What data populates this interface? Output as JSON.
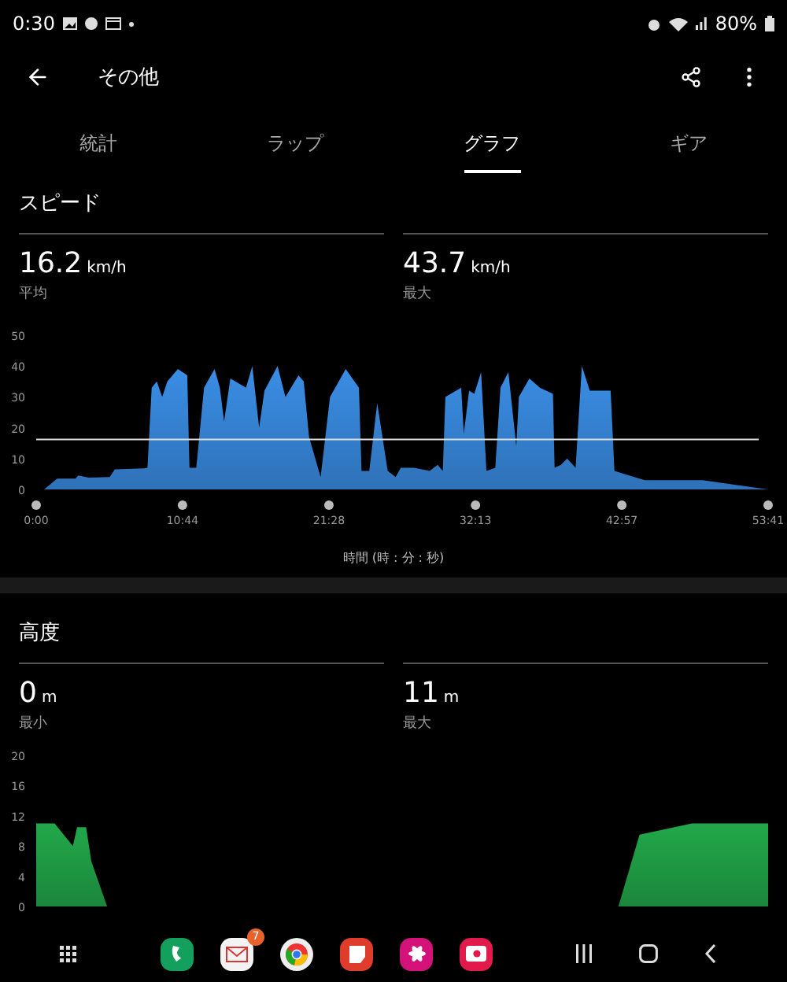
{
  "status_bar": {
    "time": "0:30",
    "battery": "80%"
  },
  "app_bar": {
    "title": "その他"
  },
  "tabs": [
    {
      "label": "統計",
      "selected": false
    },
    {
      "label": "ラップ",
      "selected": false
    },
    {
      "label": "グラフ",
      "selected": true
    },
    {
      "label": "ギア",
      "selected": false
    }
  ],
  "sections": [
    {
      "title": "スピード",
      "stats": [
        {
          "value": "16.2",
          "unit": "km/h",
          "label": "平均"
        },
        {
          "value": "43.7",
          "unit": "km/h",
          "label": "最大"
        }
      ],
      "chart_data": {
        "type": "area",
        "xlabel": "時間 (時 : 分 : 秒)",
        "xlim": [
          0,
          53.68
        ],
        "ylim": [
          0,
          50
        ],
        "yticks": [
          0,
          10,
          20,
          30,
          40,
          50
        ],
        "xticks": [
          {
            "value": 0,
            "label": "0:00"
          },
          {
            "value": 10.73,
            "label": "10:44"
          },
          {
            "value": 21.47,
            "label": "21:28"
          },
          {
            "value": 32.22,
            "label": "32:13"
          },
          {
            "value": 42.95,
            "label": "42:57"
          },
          {
            "value": 53.68,
            "label": "53:41"
          }
        ],
        "x": [
          0,
          0.58,
          1.54,
          2.89,
          3.08,
          3.85,
          5.39,
          5.77,
          7.89,
          8.16,
          8.47,
          8.85,
          9.24,
          9.62,
          10.39,
          11.08,
          11.24,
          11.74,
          12.31,
          13.08,
          13.47,
          13.78,
          14.24,
          15.39,
          15.85,
          16.35,
          16.74,
          17.7,
          18.28,
          19.24,
          19.62,
          20.01,
          20.86,
          21.55,
          22.7,
          23.67,
          23.86,
          24.43,
          25.01,
          25.78,
          26.36,
          26.74,
          27.71,
          28.86,
          29.44,
          29.82,
          30.01,
          31.17,
          31.36,
          31.75,
          32.13,
          32.63,
          33.02,
          33.67,
          34.05,
          34.63,
          35.21,
          35.4,
          36.17,
          36.94,
          37.9,
          38.02,
          38.48,
          38.94,
          39.56,
          40.02,
          40.6,
          42.13,
          42.41,
          43.48,
          44.64,
          48.87,
          53.68
        ],
        "series": [
          {
            "color": "#3a8ee6",
            "values": [
              0,
              0,
              3.5,
              3.5,
              4.5,
              3.8,
              4,
              6.5,
              6.8,
              7,
              33,
              35,
              30,
              35,
              39,
              37,
              7,
              7,
              33,
              39,
              33,
              22,
              36,
              33,
              40,
              20,
              32,
              40,
              30,
              37,
              35,
              17,
              4,
              30,
              39,
              33,
              6,
              6,
              28,
              6,
              4,
              7,
              7,
              6,
              8,
              6,
              30,
              33,
              18,
              32,
              31,
              38,
              6,
              7,
              33,
              38,
              14,
              30,
              36,
              33,
              31,
              7,
              8,
              10,
              7,
              40,
              32,
              32,
              6,
              4.5,
              3,
              3,
              0
            ]
          }
        ],
        "ref_lines": [
          {
            "axis": "y",
            "value": 16.2
          }
        ]
      }
    },
    {
      "title": "高度",
      "stats": [
        {
          "value": "0",
          "unit": "m",
          "label": "最小"
        },
        {
          "value": "11",
          "unit": "m",
          "label": "最大"
        }
      ],
      "chart_data": {
        "type": "area",
        "xlim": [
          0,
          53.68
        ],
        "ylim": [
          0,
          20
        ],
        "yticks": [
          0,
          4,
          8,
          12,
          16,
          20
        ],
        "series": [
          {
            "color": "#22a84a",
            "x": [
              0,
              1.35,
              2.69,
              3.0,
              3.66,
              4.04,
              5.2
            ],
            "values": [
              11,
              11,
              8,
              10.5,
              10.5,
              6,
              0
            ]
          },
          {
            "color": "#22a84a",
            "x": [
              42.7,
              44.25,
              48.1,
              53.68
            ],
            "values": [
              0,
              9.5,
              11,
              11
            ]
          }
        ]
      }
    }
  ],
  "nav_bar": {
    "mail_badge": "7"
  }
}
